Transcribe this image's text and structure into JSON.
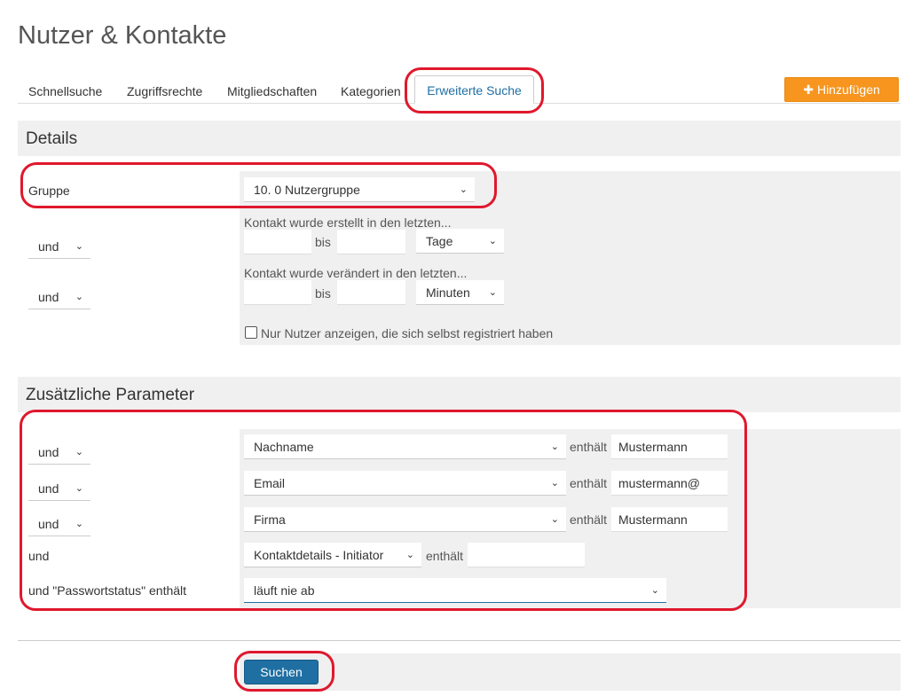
{
  "page": {
    "title": "Nutzer & Kontakte"
  },
  "tabs": [
    "Schnellsuche",
    "Zugriffsrechte",
    "Mitgliedschaften",
    "Kategorien",
    "Erweiterte Suche"
  ],
  "toolbar": {
    "add_label": "Hinzufügen",
    "add_icon": "plus-icon"
  },
  "details": {
    "title": "Details",
    "group_label": "Gruppe",
    "group_value": "10. 0 Nutzergruppe",
    "created_label": "Kontakt wurde erstellt in den letzten...",
    "created_conj": "und",
    "created_from": "",
    "created_bis": "bis",
    "created_to": "",
    "created_unit": "Tage",
    "changed_label": "Kontakt wurde verändert in den letzten...",
    "changed_conj": "und",
    "changed_from": "",
    "changed_bis": "bis",
    "changed_to": "",
    "changed_unit": "Minuten",
    "selfreg_label": "Nur Nutzer anzeigen, die sich selbst registriert haben",
    "selfreg_checked": false
  },
  "params": {
    "title": "Zusätzliche Parameter",
    "rows": [
      {
        "conj": "und",
        "field": "Nachname",
        "op": "enthält",
        "value": "Mustermann"
      },
      {
        "conj": "und",
        "field": "Email",
        "op": "enthält",
        "value": "mustermann@"
      },
      {
        "conj": "und",
        "field": "Firma",
        "op": "enthält",
        "value": "Mustermann"
      }
    ],
    "row4": {
      "conj": "und",
      "field": "Kontaktdetails - Initiator",
      "op": "enthält",
      "value": ""
    },
    "row5": {
      "label": "und \"Passwortstatus\" enthält",
      "value": "läuft nie ab"
    }
  },
  "search": {
    "label": "Suchen"
  },
  "colors": {
    "accent": "#1f6fa3",
    "add": "#f7951e",
    "highlight": "#e0182d"
  }
}
